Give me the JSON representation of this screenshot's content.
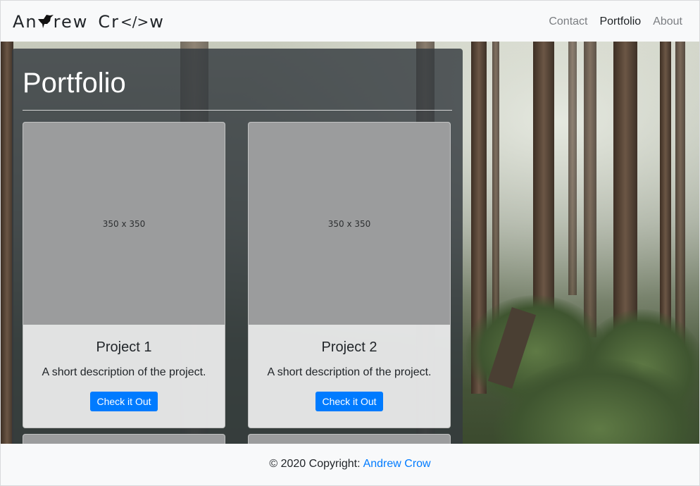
{
  "navbar": {
    "brand_part1": "An",
    "brand_part2": "rew",
    "brand_part3": "Cr",
    "brand_code": "</>",
    "brand_part4": "w",
    "links": [
      {
        "label": "Contact",
        "active": false
      },
      {
        "label": "Portfolio",
        "active": true
      },
      {
        "label": "About",
        "active": false
      }
    ]
  },
  "page_title": "Portfolio",
  "projects": [
    {
      "thumb": "350 x 350",
      "title": "Project 1",
      "description": "A short description of the project.",
      "button": "Check it Out"
    },
    {
      "thumb": "350 x 350",
      "title": "Project 2",
      "description": "A short description of the project.",
      "button": "Check it Out"
    }
  ],
  "footer": {
    "text": "© 2020 Copyright:",
    "link": "Andrew Crow"
  },
  "colors": {
    "primary": "#007bff",
    "panel": "#343a40",
    "navbar": "#f8f9fa"
  }
}
